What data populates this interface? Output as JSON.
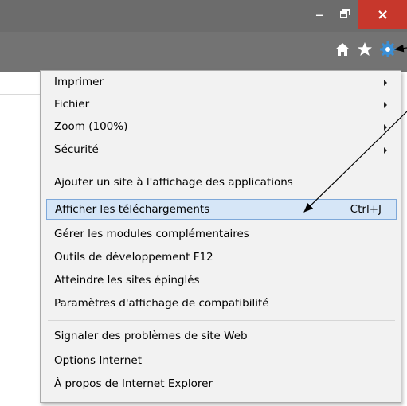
{
  "window": {
    "minimize_glyph": "–",
    "close_glyph": "×"
  },
  "toolbar": {
    "icons": [
      "home-icon",
      "star-icon",
      "gear-icon"
    ]
  },
  "menu": {
    "items": [
      {
        "label": "Imprimer",
        "submenu": true
      },
      {
        "label": "Fichier",
        "submenu": true
      },
      {
        "label": "Zoom (100%)",
        "submenu": true
      },
      {
        "label": "Sécurité",
        "submenu": true
      },
      {
        "label": "Ajouter un site à l'affichage des applications"
      },
      {
        "label": "Afficher les téléchargements",
        "shortcut": "Ctrl+J",
        "highlighted": true
      },
      {
        "label": "Gérer les modules complémentaires"
      },
      {
        "label": "Outils de développement F12"
      },
      {
        "label": "Atteindre les sites épinglés"
      },
      {
        "label": "Paramètres d'affichage de compatibilité"
      },
      {
        "label": "Signaler des problèmes de site Web"
      },
      {
        "label": "Options Internet"
      },
      {
        "label": "À propos de Internet Explorer"
      }
    ]
  },
  "colors": {
    "titlebar": "#6c6c6c",
    "close_button": "#c7372c",
    "gear_accent": "#3a8fd6",
    "highlight_bg": "#d6e6f7",
    "highlight_border": "#7ea8d9"
  }
}
